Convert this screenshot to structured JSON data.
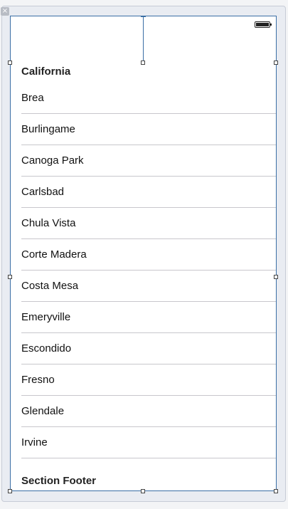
{
  "table": {
    "section_header": "California",
    "rows": [
      "Brea",
      "Burlingame",
      "Canoga Park",
      "Carlsbad",
      "Chula Vista",
      "Corte Madera",
      "Costa Mesa",
      "Emeryville",
      "Escondido",
      "Fresno",
      "Glendale",
      "Irvine"
    ],
    "section_footer": "Section Footer"
  },
  "icons": {
    "close": "close-icon",
    "battery": "battery-icon"
  },
  "colors": {
    "selection_border": "#3a6ea5",
    "separator": "#c8c7cc"
  }
}
